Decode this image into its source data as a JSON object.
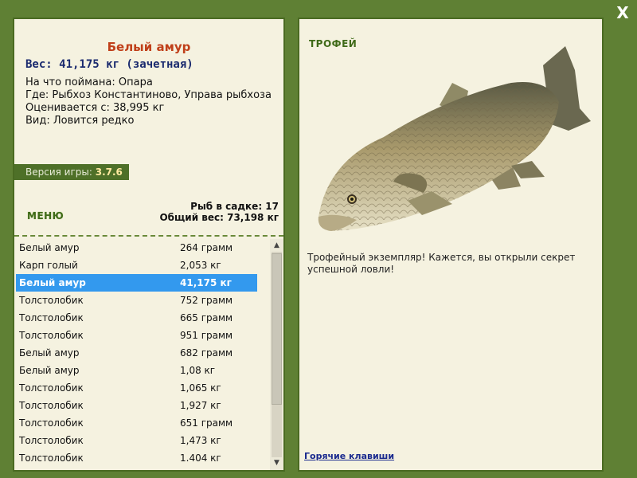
{
  "close_label": "X",
  "fish": {
    "title": "Белый амур",
    "weight": "Вес: 41,175 кг (зачетная)",
    "caught_on": "На что поймана: Опара",
    "location": "Где: Рыбхоз Константиново, Управа рыбхоза",
    "valued_from": "Оценивается с: 38,995 кг",
    "rarity": "Вид: Ловится редко"
  },
  "version": {
    "label": "Версия игры:",
    "value": "3.7.6"
  },
  "menu_label": "МЕНЮ",
  "stats": {
    "count": "Рыб в садке: 17",
    "total_weight": "Общий вес: 73,198 кг"
  },
  "catch_list": [
    {
      "name": "Белый амур",
      "weight": "264 грамм"
    },
    {
      "name": "Карп голый",
      "weight": "2,053 кг"
    },
    {
      "name": "Белый амур",
      "weight": "41,175 кг"
    },
    {
      "name": "Толстолобик",
      "weight": "752 грамм"
    },
    {
      "name": "Толстолобик",
      "weight": "665 грамм"
    },
    {
      "name": "Толстолобик",
      "weight": "951 грамм"
    },
    {
      "name": "Белый амур",
      "weight": "682 грамм"
    },
    {
      "name": "Белый амур",
      "weight": "1,08 кг"
    },
    {
      "name": "Толстолобик",
      "weight": "1,065 кг"
    },
    {
      "name": "Толстолобик",
      "weight": "1,927 кг"
    },
    {
      "name": "Толстолобик",
      "weight": "651 грамм"
    },
    {
      "name": "Толстолобик",
      "weight": "1,473 кг"
    },
    {
      "name": "Толстолобик",
      "weight": "1.404 кг"
    }
  ],
  "selected_index": 2,
  "trophy_label": "ТРОФЕЙ",
  "description": "Трофейный экземпляр! Кажется, вы открыли секрет успешной ловли!",
  "hotkeys_label": "Горячие клавиши",
  "colors": {
    "frame": "#5f8034",
    "panel": "#f5f2e0",
    "selected": "#3399ee",
    "title": "#c0401a"
  }
}
